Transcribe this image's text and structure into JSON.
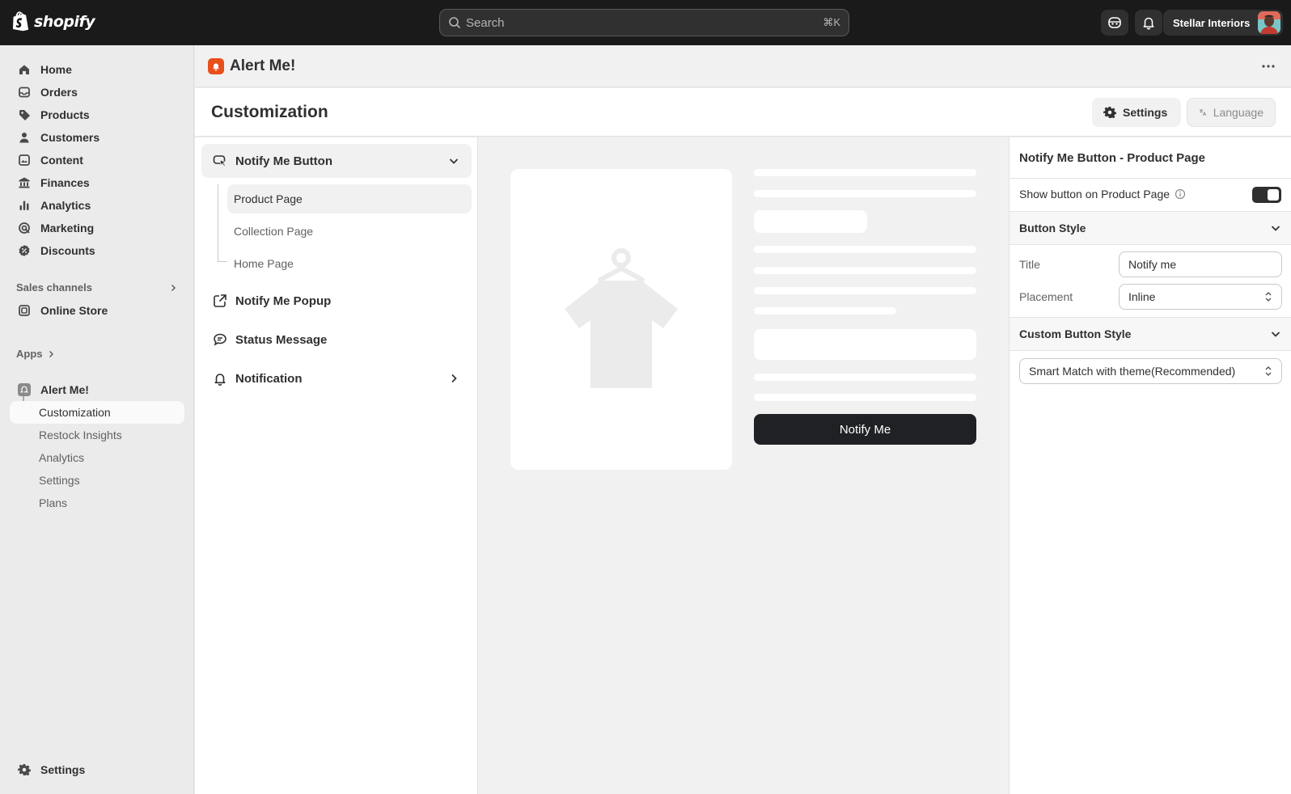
{
  "topbar": {
    "brand": "shopify",
    "search_placeholder": "Search",
    "search_shortcut": "⌘K",
    "store_name": "Stellar Interiors"
  },
  "sidebar": {
    "main_items": [
      {
        "label": "Home",
        "icon": "home-icon"
      },
      {
        "label": "Orders",
        "icon": "inbox-icon"
      },
      {
        "label": "Products",
        "icon": "tag-icon"
      },
      {
        "label": "Customers",
        "icon": "person-icon"
      },
      {
        "label": "Content",
        "icon": "content-icon"
      },
      {
        "label": "Finances",
        "icon": "bank-icon"
      },
      {
        "label": "Analytics",
        "icon": "bar-chart-icon"
      },
      {
        "label": "Marketing",
        "icon": "target-icon"
      },
      {
        "label": "Discounts",
        "icon": "discount-icon"
      }
    ],
    "sales_channels_label": "Sales channels",
    "online_store_label": "Online Store",
    "apps_label": "Apps",
    "app_name": "Alert Me!",
    "app_sub_items": [
      "Customization",
      "Restock Insights",
      "Analytics",
      "Settings",
      "Plans"
    ],
    "settings_label": "Settings"
  },
  "app_header": {
    "title": "Alert Me!"
  },
  "page": {
    "title": "Customization",
    "settings_button": "Settings",
    "language_button": "Language"
  },
  "left_panel": {
    "notify_me_button": "Notify Me Button",
    "sub_items": [
      "Product Page",
      "Collection Page",
      "Home Page"
    ],
    "notify_me_popup": "Notify Me Popup",
    "status_message": "Status Message",
    "notification": "Notification"
  },
  "preview": {
    "button_label": "Notify Me"
  },
  "right_panel": {
    "title": "Notify Me Button - Product Page",
    "show_button_label": "Show button on Product Page",
    "show_button_enabled": true,
    "button_style_label": "Button Style",
    "title_label": "Title",
    "title_value": "Notify me",
    "placement_label": "Placement",
    "placement_value": "Inline",
    "custom_style_label": "Custom Button Style",
    "custom_style_value": "Smart Match with theme(Recommended)"
  },
  "colors": {
    "topbar": "#1a1a1a",
    "app_badge": "#e8501b",
    "primary_button": "#202124"
  }
}
